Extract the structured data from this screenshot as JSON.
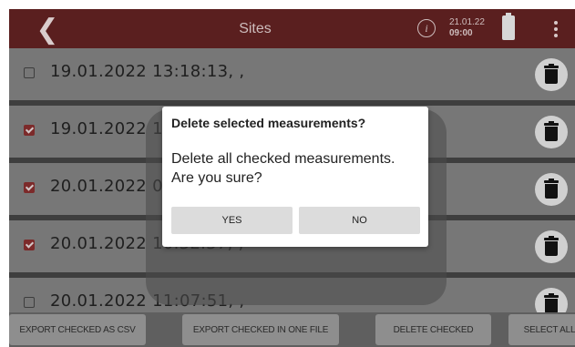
{
  "header": {
    "back_icon": "chevron-left-icon",
    "title": "Sites",
    "info_icon": "info-icon",
    "date": "21.01.22",
    "time": "09:00",
    "battery_icon": "battery-icon",
    "menu_icon": "more-vert-icon"
  },
  "rows": [
    {
      "text": "19.01.2022 13:18:13, ,",
      "checked": false
    },
    {
      "text": "19.01.2022 13",
      "checked": true
    },
    {
      "text": "20.01.2022 09",
      "checked": true
    },
    {
      "text": "20.01.2022 10.32.37, ,",
      "checked": true
    },
    {
      "text": "20.01.2022 11:07:51, ,",
      "checked": false
    }
  ],
  "dialog": {
    "title": "Delete selected measurements?",
    "message_line1": "Delete all checked measurements.",
    "message_line2": "Are you sure?",
    "yes_label": "YES",
    "no_label": "NO"
  },
  "footer": {
    "export_csv": "EXPORT CHECKED AS CSV",
    "export_one_file": "EXPORT CHECKED IN ONE FILE",
    "delete_checked": "DELETE CHECKED",
    "select_all": "SELECT ALL"
  },
  "colors": {
    "header_bg": "#5a1f1f",
    "checkbox_checked": "#7c2a2a",
    "row_bg": "#777777"
  }
}
